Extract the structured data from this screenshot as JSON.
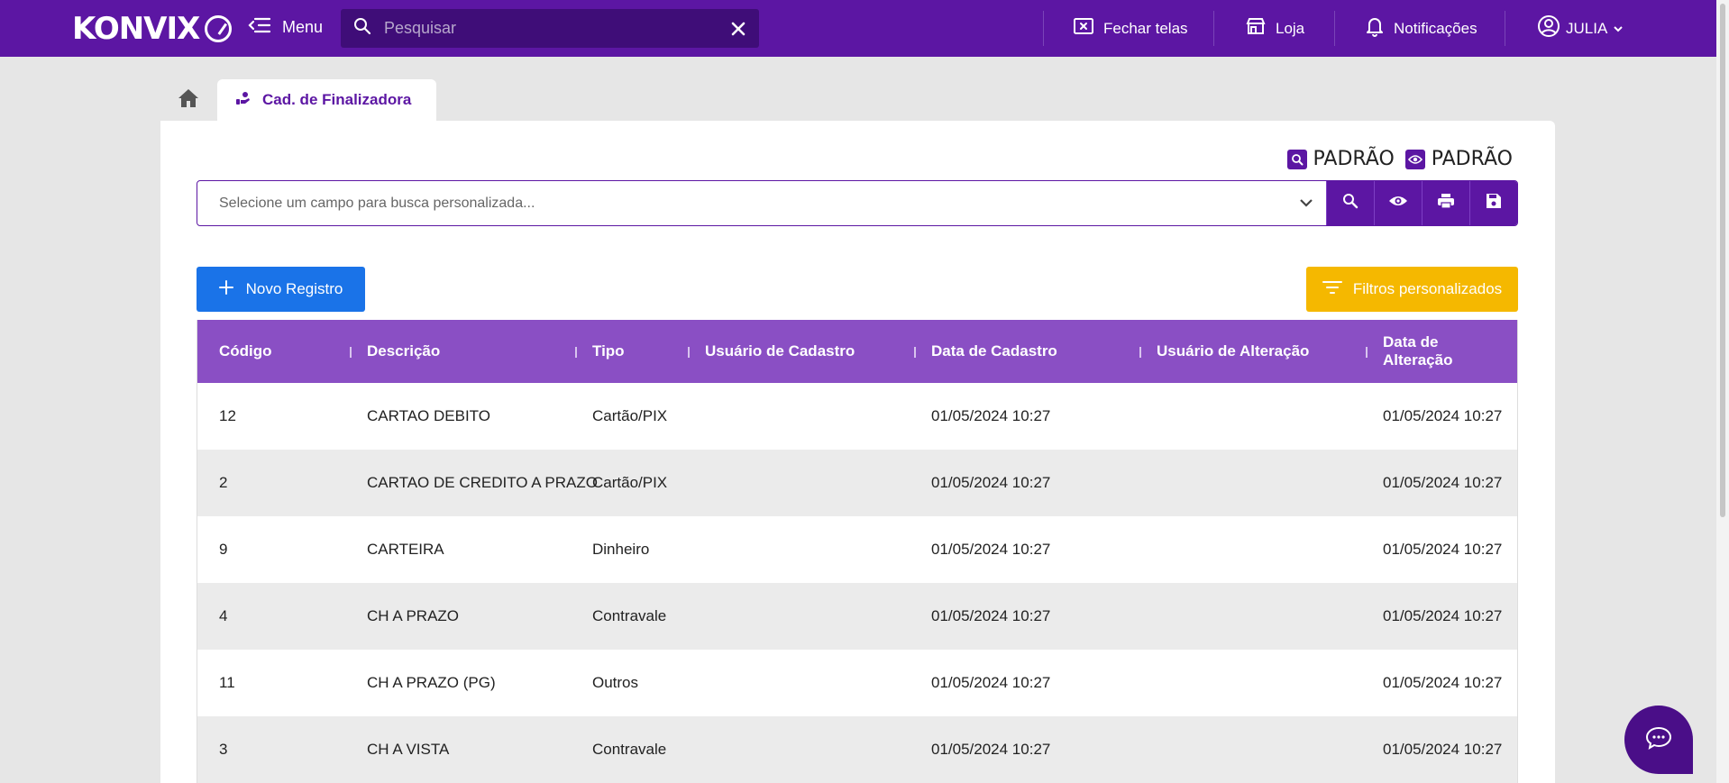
{
  "topbar": {
    "logo": "KONVIX",
    "menu_label": "Menu",
    "search_placeholder": "Pesquisar",
    "close_screens_label": "Fechar telas",
    "store_label": "Loja",
    "notifications_label": "Notificações",
    "user_label": "JULIA"
  },
  "tabs": {
    "active_label": "Cad. de Finalizadora"
  },
  "profiles": {
    "search_profile": "PADRÃO",
    "view_profile": "PADRÃO"
  },
  "filter": {
    "placeholder": "Selecione um campo para busca personalizada..."
  },
  "actions": {
    "new_record": "Novo Registro",
    "custom_filters": "Filtros personalizados"
  },
  "table": {
    "columns": [
      "Código",
      "Descrição",
      "Tipo",
      "Usuário de Cadastro",
      "Data de Cadastro",
      "Usuário de Alteração",
      "Data de Alteração"
    ],
    "rows": [
      {
        "codigo": "12",
        "descricao": "CARTAO DEBITO",
        "tipo": "Cartão/PIX",
        "usuario_cadastro": "",
        "data_cadastro": "01/05/2024 10:27",
        "usuario_alteracao": "",
        "data_alteracao": "01/05/2024 10:27"
      },
      {
        "codigo": "2",
        "descricao": "CARTAO DE CREDITO A PRAZO",
        "tipo": "Cartão/PIX",
        "usuario_cadastro": "",
        "data_cadastro": "01/05/2024 10:27",
        "usuario_alteracao": "",
        "data_alteracao": "01/05/2024 10:27"
      },
      {
        "codigo": "9",
        "descricao": "CARTEIRA",
        "tipo": "Dinheiro",
        "usuario_cadastro": "",
        "data_cadastro": "01/05/2024 10:27",
        "usuario_alteracao": "",
        "data_alteracao": "01/05/2024 10:27"
      },
      {
        "codigo": "4",
        "descricao": "CH A PRAZO",
        "tipo": "Contravale",
        "usuario_cadastro": "",
        "data_cadastro": "01/05/2024 10:27",
        "usuario_alteracao": "",
        "data_alteracao": "01/05/2024 10:27"
      },
      {
        "codigo": "11",
        "descricao": "CH A PRAZO (PG)",
        "tipo": "Outros",
        "usuario_cadastro": "",
        "data_cadastro": "01/05/2024 10:27",
        "usuario_alteracao": "",
        "data_alteracao": "01/05/2024 10:27"
      },
      {
        "codigo": "3",
        "descricao": "CH A VISTA",
        "tipo": "Contravale",
        "usuario_cadastro": "",
        "data_cadastro": "01/05/2024 10:27",
        "usuario_alteracao": "",
        "data_alteracao": "01/05/2024 10:27"
      }
    ]
  },
  "colors": {
    "primary": "#5c16a3",
    "header_row": "#8a4fc4",
    "new_button": "#1a73e8",
    "filters_button": "#f5b800"
  },
  "icons": [
    "menu-icon",
    "search-icon",
    "close-icon",
    "close-screens-icon",
    "store-icon",
    "bell-icon",
    "user-circle-icon",
    "chevron-down-icon",
    "home-icon",
    "finalizer-icon",
    "eye-icon",
    "print-icon",
    "save-icon",
    "plus-icon",
    "filter-icon",
    "chat-icon"
  ]
}
